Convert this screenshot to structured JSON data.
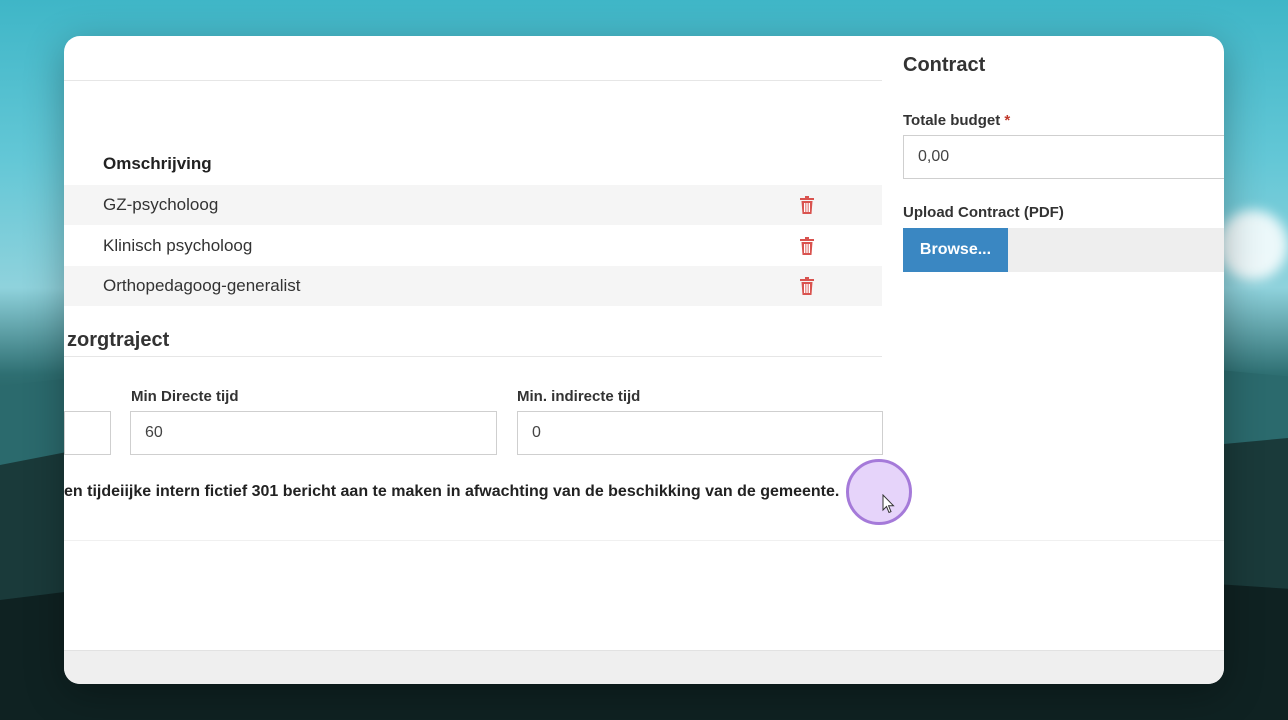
{
  "table": {
    "header": "Omschrijving",
    "rows": [
      {
        "label": "GZ-psycholoog"
      },
      {
        "label": "Klinisch psycholoog"
      },
      {
        "label": "Orthopedagoog-generalist"
      }
    ]
  },
  "zorgtraject": {
    "title": "zorgtraject",
    "min_direct_label": "Min Directe tijd",
    "min_direct_value": "60",
    "min_indirect_label": "Min. indirecte tijd",
    "min_indirect_value": "0"
  },
  "note": "en tijdeiijke intern fictief 301 bericht aan te maken in afwachting van de beschikking van de gemeente.",
  "contract": {
    "title": "Contract",
    "budget_label": "Totale budget",
    "required_marker": "*",
    "budget_value": "0,00",
    "upload_label": "Upload Contract (PDF)",
    "browse_label": "Browse..."
  },
  "colors": {
    "primary_button": "#3a87c2",
    "delete_icon": "#d9534f",
    "cursor_highlight": "#a57ad9"
  }
}
